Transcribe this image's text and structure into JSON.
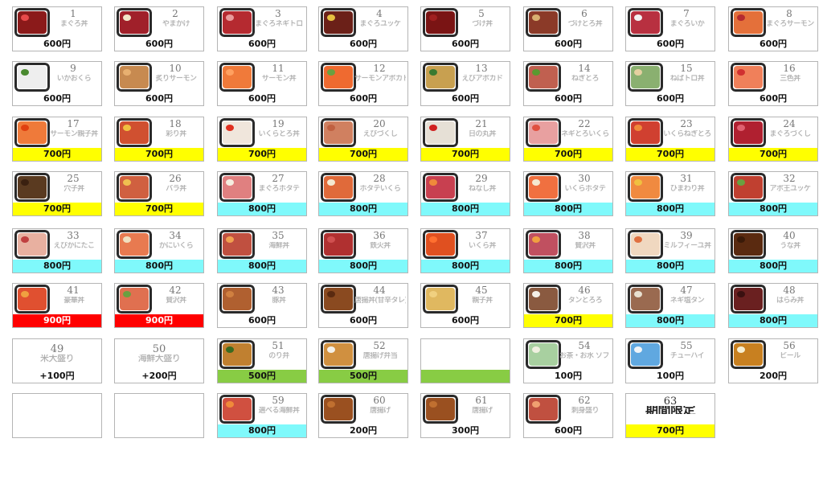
{
  "colors": {
    "yellow": "#ffff00",
    "cyan": "#7ff9fb",
    "red": "#ff0000",
    "green": "#88cc44",
    "white": "#ffffff"
  },
  "items": [
    {
      "num": "1",
      "name": "まぐろ丼",
      "price": "600円",
      "bg": "white",
      "food": "#8b1a1a",
      "top": "#e84a4a"
    },
    {
      "num": "2",
      "name": "やまかけ",
      "price": "600円",
      "bg": "white",
      "food": "#a0202a",
      "top": "#f1e6c8"
    },
    {
      "num": "3",
      "name": "まぐろネギトロ",
      "price": "600円",
      "bg": "white",
      "food": "#b52a30",
      "top": "#e99b9b"
    },
    {
      "num": "4",
      "name": "まぐろユッケ",
      "price": "600円",
      "bg": "white",
      "food": "#6b2018",
      "top": "#e6c040"
    },
    {
      "num": "5",
      "name": "づけ丼",
      "price": "600円",
      "bg": "white",
      "food": "#7a1414",
      "top": "#a02020"
    },
    {
      "num": "6",
      "name": "づけとろ丼",
      "price": "600円",
      "bg": "white",
      "food": "#8b3a28",
      "top": "#d8b070"
    },
    {
      "num": "7",
      "name": "まぐろいか",
      "price": "600円",
      "bg": "white",
      "food": "#b83040",
      "top": "#f2f2f2"
    },
    {
      "num": "8",
      "name": "まぐろサーモン",
      "price": "600円",
      "bg": "white",
      "food": "#e4703a",
      "top": "#b52a30"
    },
    {
      "num": "9",
      "name": "いかおくら",
      "price": "600円",
      "bg": "white",
      "food": "#eeeeee",
      "top": "#4a8a30"
    },
    {
      "num": "10",
      "name": "炙りサーモン",
      "price": "600円",
      "bg": "white",
      "food": "#c78a50",
      "top": "#e8b070"
    },
    {
      "num": "11",
      "name": "サーモン丼",
      "price": "600円",
      "bg": "white",
      "food": "#f07a3a",
      "top": "#ffa060"
    },
    {
      "num": "12",
      "name": "サーモンアボカド",
      "price": "600円",
      "bg": "white",
      "food": "#ef6a30",
      "top": "#6aa040"
    },
    {
      "num": "13",
      "name": "えびアボカド",
      "price": "600円",
      "bg": "white",
      "food": "#c8a050",
      "top": "#3a7a30"
    },
    {
      "num": "14",
      "name": "ねぎとろ",
      "price": "600円",
      "bg": "white",
      "food": "#c06050",
      "top": "#5a9a30"
    },
    {
      "num": "15",
      "name": "ねばトロ丼",
      "price": "600円",
      "bg": "white",
      "food": "#8ab070",
      "top": "#e5d0a0"
    },
    {
      "num": "16",
      "name": "三色丼",
      "price": "600円",
      "bg": "white",
      "food": "#f0805a",
      "top": "#d03030"
    },
    {
      "num": "17",
      "name": "サーモン親子丼",
      "price": "700円",
      "bg": "yellow",
      "food": "#ef7a3a",
      "top": "#e04010"
    },
    {
      "num": "18",
      "name": "彩り丼",
      "price": "700円",
      "bg": "yellow",
      "food": "#d05030",
      "top": "#f0c040"
    },
    {
      "num": "19",
      "name": "いくらとろ丼",
      "price": "700円",
      "bg": "yellow",
      "food": "#f0e6dc",
      "top": "#e03020"
    },
    {
      "num": "20",
      "name": "えびづくし",
      "price": "700円",
      "bg": "yellow",
      "food": "#d08060",
      "top": "#c06040"
    },
    {
      "num": "21",
      "name": "日の丸丼",
      "price": "700円",
      "bg": "yellow",
      "food": "#e6e0d6",
      "top": "#d02020"
    },
    {
      "num": "22",
      "name": "ネギとろいくら",
      "price": "700円",
      "bg": "yellow",
      "food": "#e8a0a0",
      "top": "#e05040"
    },
    {
      "num": "23",
      "name": "いくらねぎとろ",
      "price": "700円",
      "bg": "yellow",
      "food": "#d04030",
      "top": "#f08a3a"
    },
    {
      "num": "24",
      "name": "まぐろづくし",
      "price": "700円",
      "bg": "yellow",
      "food": "#b02030",
      "top": "#e06070"
    },
    {
      "num": "25",
      "name": "穴子丼",
      "price": "700円",
      "bg": "yellow",
      "food": "#5a3a20",
      "top": "#3a2010"
    },
    {
      "num": "26",
      "name": "バラ丼",
      "price": "700円",
      "bg": "yellow",
      "food": "#d06040",
      "top": "#f0c050"
    },
    {
      "num": "27",
      "name": "まぐろホタテ",
      "price": "800円",
      "bg": "cyan",
      "food": "#e08080",
      "top": "#f5eee0"
    },
    {
      "num": "28",
      "name": "ホタテいくら",
      "price": "800円",
      "bg": "cyan",
      "food": "#e06a3a",
      "top": "#f4e8d0"
    },
    {
      "num": "29",
      "name": "ねなし丼",
      "price": "800円",
      "bg": "cyan",
      "food": "#c84050",
      "top": "#f08a3a"
    },
    {
      "num": "30",
      "name": "いくらホタテ",
      "price": "800円",
      "bg": "cyan",
      "food": "#f07040",
      "top": "#f4e8d0"
    },
    {
      "num": "31",
      "name": "ひまわり丼",
      "price": "800円",
      "bg": "cyan",
      "food": "#f08a40",
      "top": "#f0c040"
    },
    {
      "num": "32",
      "name": "アボ王ユッケ",
      "price": "800円",
      "bg": "cyan",
      "food": "#c04030",
      "top": "#6aa040"
    },
    {
      "num": "33",
      "name": "えびかにたこ",
      "price": "800円",
      "bg": "cyan",
      "food": "#e8b0a0",
      "top": "#c04040"
    },
    {
      "num": "34",
      "name": "かにいくら",
      "price": "800円",
      "bg": "cyan",
      "food": "#e87a50",
      "top": "#f0e0c0"
    },
    {
      "num": "35",
      "name": "海鮮丼",
      "price": "800円",
      "bg": "cyan",
      "food": "#c05040",
      "top": "#f0a050"
    },
    {
      "num": "36",
      "name": "鉄火丼",
      "price": "800円",
      "bg": "cyan",
      "food": "#b03030",
      "top": "#d05050"
    },
    {
      "num": "37",
      "name": "いくら丼",
      "price": "800円",
      "bg": "cyan",
      "food": "#e05020",
      "top": "#ff7030"
    },
    {
      "num": "38",
      "name": "贅沢丼",
      "price": "800円",
      "bg": "cyan",
      "food": "#c05060",
      "top": "#f0a040"
    },
    {
      "num": "39",
      "name": "ミルフィーユ丼",
      "price": "800円",
      "bg": "cyan",
      "food": "#f0d8c0",
      "top": "#e07040"
    },
    {
      "num": "40",
      "name": "うな丼",
      "price": "800円",
      "bg": "cyan",
      "food": "#5a2a10",
      "top": "#3a1a08"
    },
    {
      "num": "41",
      "name": "豪華丼",
      "price": "900円",
      "bg": "red",
      "food": "#e05030",
      "top": "#f0a040"
    },
    {
      "num": "42",
      "name": "贅沢丼",
      "price": "900円",
      "bg": "red",
      "food": "#e07050",
      "top": "#6aa040"
    },
    {
      "num": "43",
      "name": "豚丼",
      "price": "600円",
      "bg": "white",
      "food": "#b06030",
      "top": "#d08040"
    },
    {
      "num": "44",
      "name": "唐揚丼(甘辛タレ)",
      "price": "600円",
      "bg": "white",
      "food": "#8a4a20",
      "top": "#5a2a10"
    },
    {
      "num": "45",
      "name": "親子丼",
      "price": "600円",
      "bg": "white",
      "food": "#e0b860",
      "top": "#f0d080"
    },
    {
      "num": "46",
      "name": "タンとろろ",
      "price": "700円",
      "bg": "yellow",
      "food": "#8a5a40",
      "top": "#f4f0e8"
    },
    {
      "num": "47",
      "name": "ネギ塩タン",
      "price": "800円",
      "bg": "cyan",
      "food": "#9a6a50",
      "top": "#e8e0d0"
    },
    {
      "num": "48",
      "name": "はらみ丼",
      "price": "800円",
      "bg": "cyan",
      "food": "#6a2020",
      "top": "#3a1010"
    },
    {
      "num": "49",
      "name": "米大盛り",
      "price": "+100円",
      "bg": "white",
      "food": "",
      "top": ""
    },
    {
      "num": "50",
      "name": "海鮮大盛り",
      "price": "+200円",
      "bg": "white",
      "food": "",
      "top": ""
    },
    {
      "num": "51",
      "name": "のり弁",
      "price": "500円",
      "bg": "green",
      "food": "#c08030",
      "top": "#3a6a20"
    },
    {
      "num": "52",
      "name": "唐揚げ弁当",
      "price": "500円",
      "bg": "green",
      "food": "#d09040",
      "top": "#f4f0e8"
    },
    {
      "num": "",
      "name": "",
      "price": "",
      "bg": "green",
      "food": "",
      "top": ""
    },
    {
      "num": "54",
      "name": "お茶・お水 ソフトドリンク 各種",
      "price": "100円",
      "bg": "white",
      "food": "#a8d0a0",
      "top": "#f0f0e0"
    },
    {
      "num": "55",
      "name": "チューハイ",
      "price": "100円",
      "bg": "white",
      "food": "#60a8e0",
      "top": "#f0f4f8"
    },
    {
      "num": "56",
      "name": "ビール",
      "price": "200円",
      "bg": "white",
      "food": "#c88020",
      "top": "#f6eed0"
    },
    {
      "num": "",
      "name": "",
      "price": "",
      "bg": "white",
      "food": "",
      "top": ""
    },
    {
      "num": "",
      "name": "",
      "price": "",
      "bg": "white",
      "food": "",
      "top": ""
    },
    {
      "num": "59",
      "name": "選べる海鮮丼",
      "price": "800円",
      "bg": "cyan",
      "food": "#d05040",
      "top": "#f08a3a"
    },
    {
      "num": "60",
      "name": "唐揚げ",
      "price": "200円",
      "bg": "white",
      "food": "#9a5020",
      "top": "#c07030"
    },
    {
      "num": "61",
      "name": "唐揚げ",
      "price": "300円",
      "bg": "white",
      "food": "#9a5020",
      "top": "#c07030"
    },
    {
      "num": "62",
      "name": "刺身盛り",
      "price": "600円",
      "bg": "white",
      "food": "#c05040",
      "top": "#f0a070"
    },
    {
      "num": "63",
      "name": "期間限定",
      "price": "700円",
      "bg": "yellow",
      "food": "",
      "top": ""
    }
  ]
}
